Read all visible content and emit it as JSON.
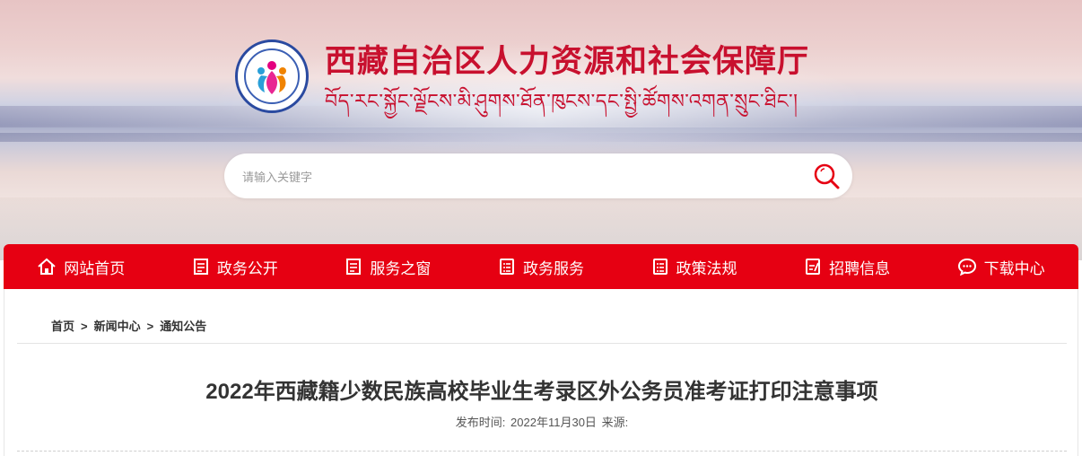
{
  "header": {
    "title": "西藏自治区人力资源和社会保障厅",
    "subtitle": "བོད་རང་སྐྱོང་ལྗོངས་མི་ཤུགས་ཐོན་ཁུངས་དང་སྤྱི་ཚོགས་འགན་སྲུང་ཐིང་།",
    "logo_icon": "department-emblem"
  },
  "search": {
    "placeholder": "请输入关键字",
    "button_icon": "search-icon"
  },
  "nav": {
    "items": [
      {
        "label": "网站首页",
        "icon": "home-icon"
      },
      {
        "label": "政务公开",
        "icon": "document-icon"
      },
      {
        "label": "服务之窗",
        "icon": "document-icon"
      },
      {
        "label": "政务服务",
        "icon": "list-icon"
      },
      {
        "label": "政策法规",
        "icon": "list-icon"
      },
      {
        "label": "招聘信息",
        "icon": "edit-icon"
      },
      {
        "label": "下载中心",
        "icon": "chat-icon"
      }
    ]
  },
  "breadcrumb": {
    "items": [
      "首页",
      "新闻中心",
      "通知公告"
    ],
    "separator": ">"
  },
  "article": {
    "title": "2022年西藏籍少数民族高校毕业生考录区外公务员准考证打印注意事项",
    "published_label": "发布时间:",
    "published_date": "2022年11月30日",
    "source_label": "来源:"
  },
  "colors": {
    "brand_red": "#e60012",
    "title_red": "#c8102e",
    "emblem_blue": "#2a4aa0"
  }
}
